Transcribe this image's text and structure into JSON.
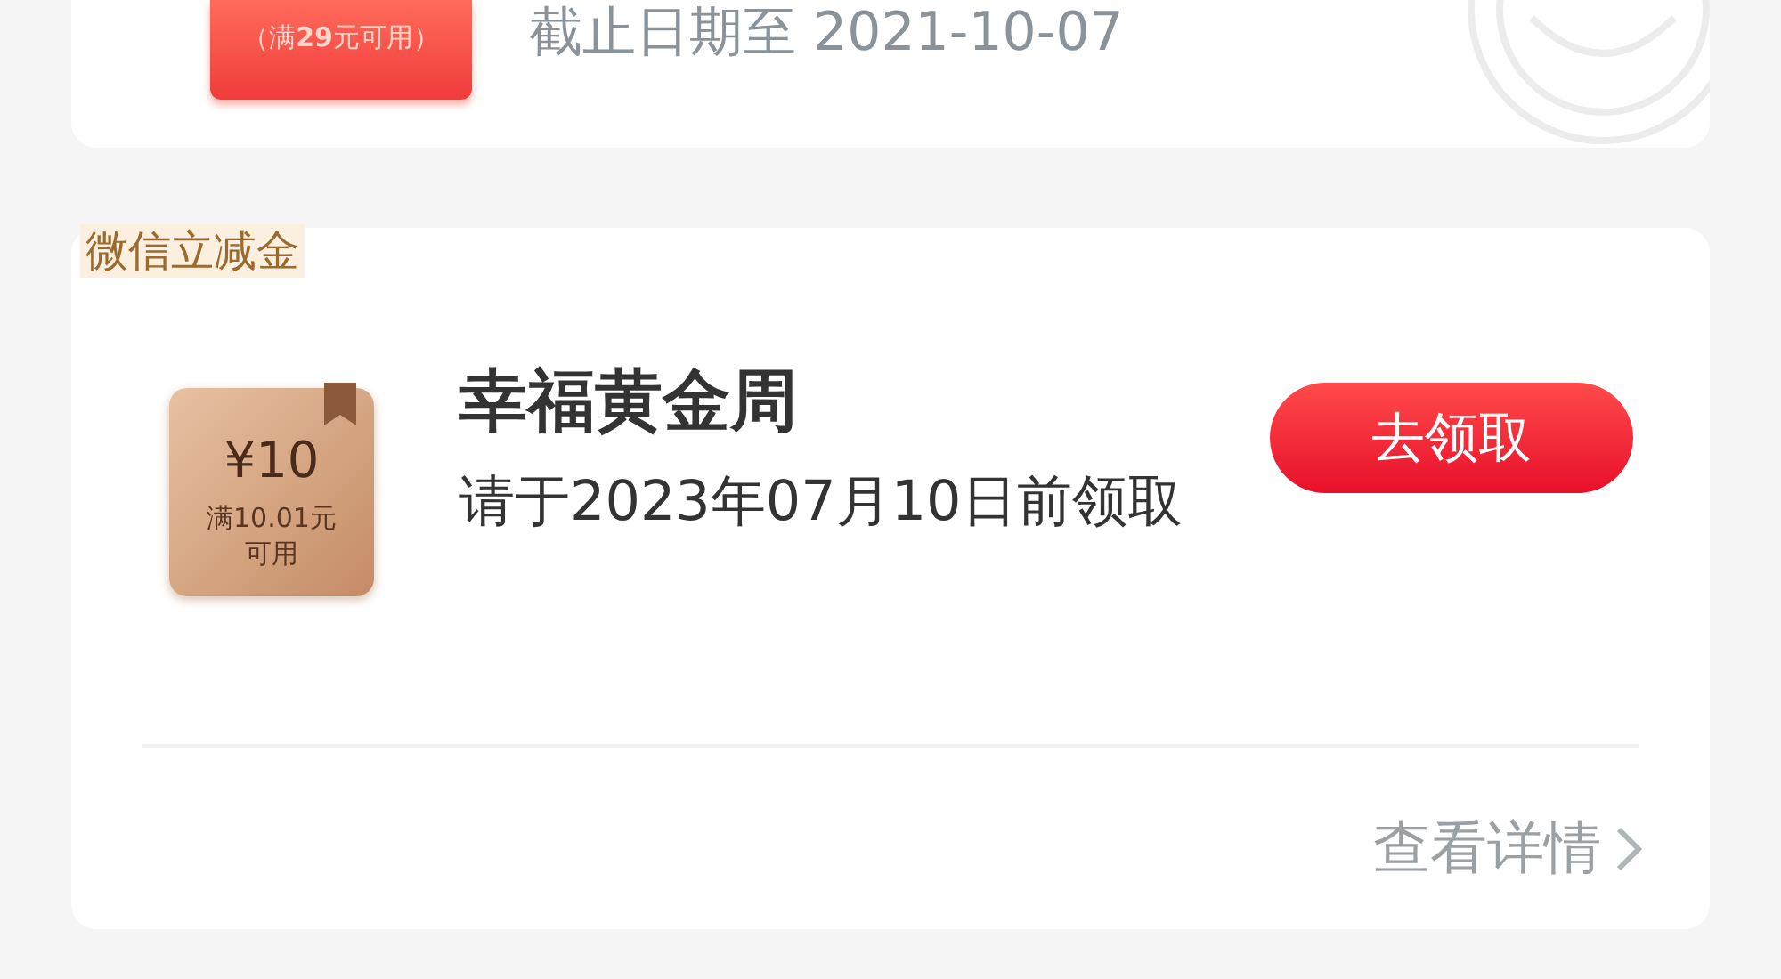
{
  "previous_coupon": {
    "condition": "（满**29**元可用）",
    "deadline": "截止日期至 2021-10-07"
  },
  "section_label": "微信立减金",
  "coupon": {
    "amount": "¥10",
    "condition": "满10.01元可用",
    "title": "幸福黄金周",
    "deadline": "请于2023年07月10日前领取",
    "claim_button": "去领取",
    "details_link": "查看详情"
  }
}
